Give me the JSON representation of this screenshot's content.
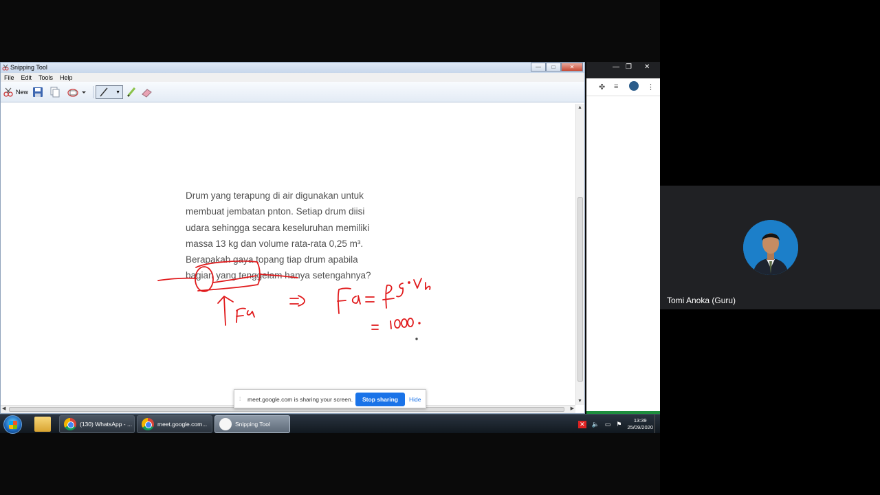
{
  "snipping_tool": {
    "title": "Snipping Tool",
    "menu": [
      "File",
      "Edit",
      "Tools",
      "Help"
    ],
    "toolbar": {
      "new_label": "New"
    },
    "problem_lines": [
      "Drum yang terapung di air digunakan untuk",
      "membuat jembatan pnton. Setiap drum diisi",
      "udara sehingga secara keseluruhan memiliki",
      "massa 13 kg dan volume rata-rata 0,25 m³.",
      "Berapakah gaya topang tiap drum apabila",
      "bagian yang tenggelam hanya setengahnya?"
    ],
    "handwriting_labels": {
      "force_label": "Fa",
      "arrow": "⇒",
      "formula": "Fa = ρ · g · Vb",
      "value": "= 1000 ·"
    },
    "ink_color": "#e0191b"
  },
  "share_bar": {
    "message": "meet.google.com is sharing your screen.",
    "stop_label": "Stop sharing",
    "hide_label": "Hide"
  },
  "taskbar": {
    "items": [
      {
        "label": "(130) WhatsApp - ..."
      },
      {
        "label": "meet.google.com..."
      },
      {
        "label": "Snipping Tool"
      }
    ],
    "time": "13:39",
    "date": "25/09/2020"
  },
  "participant": {
    "name": "Tomi Anoka (Guru)"
  }
}
